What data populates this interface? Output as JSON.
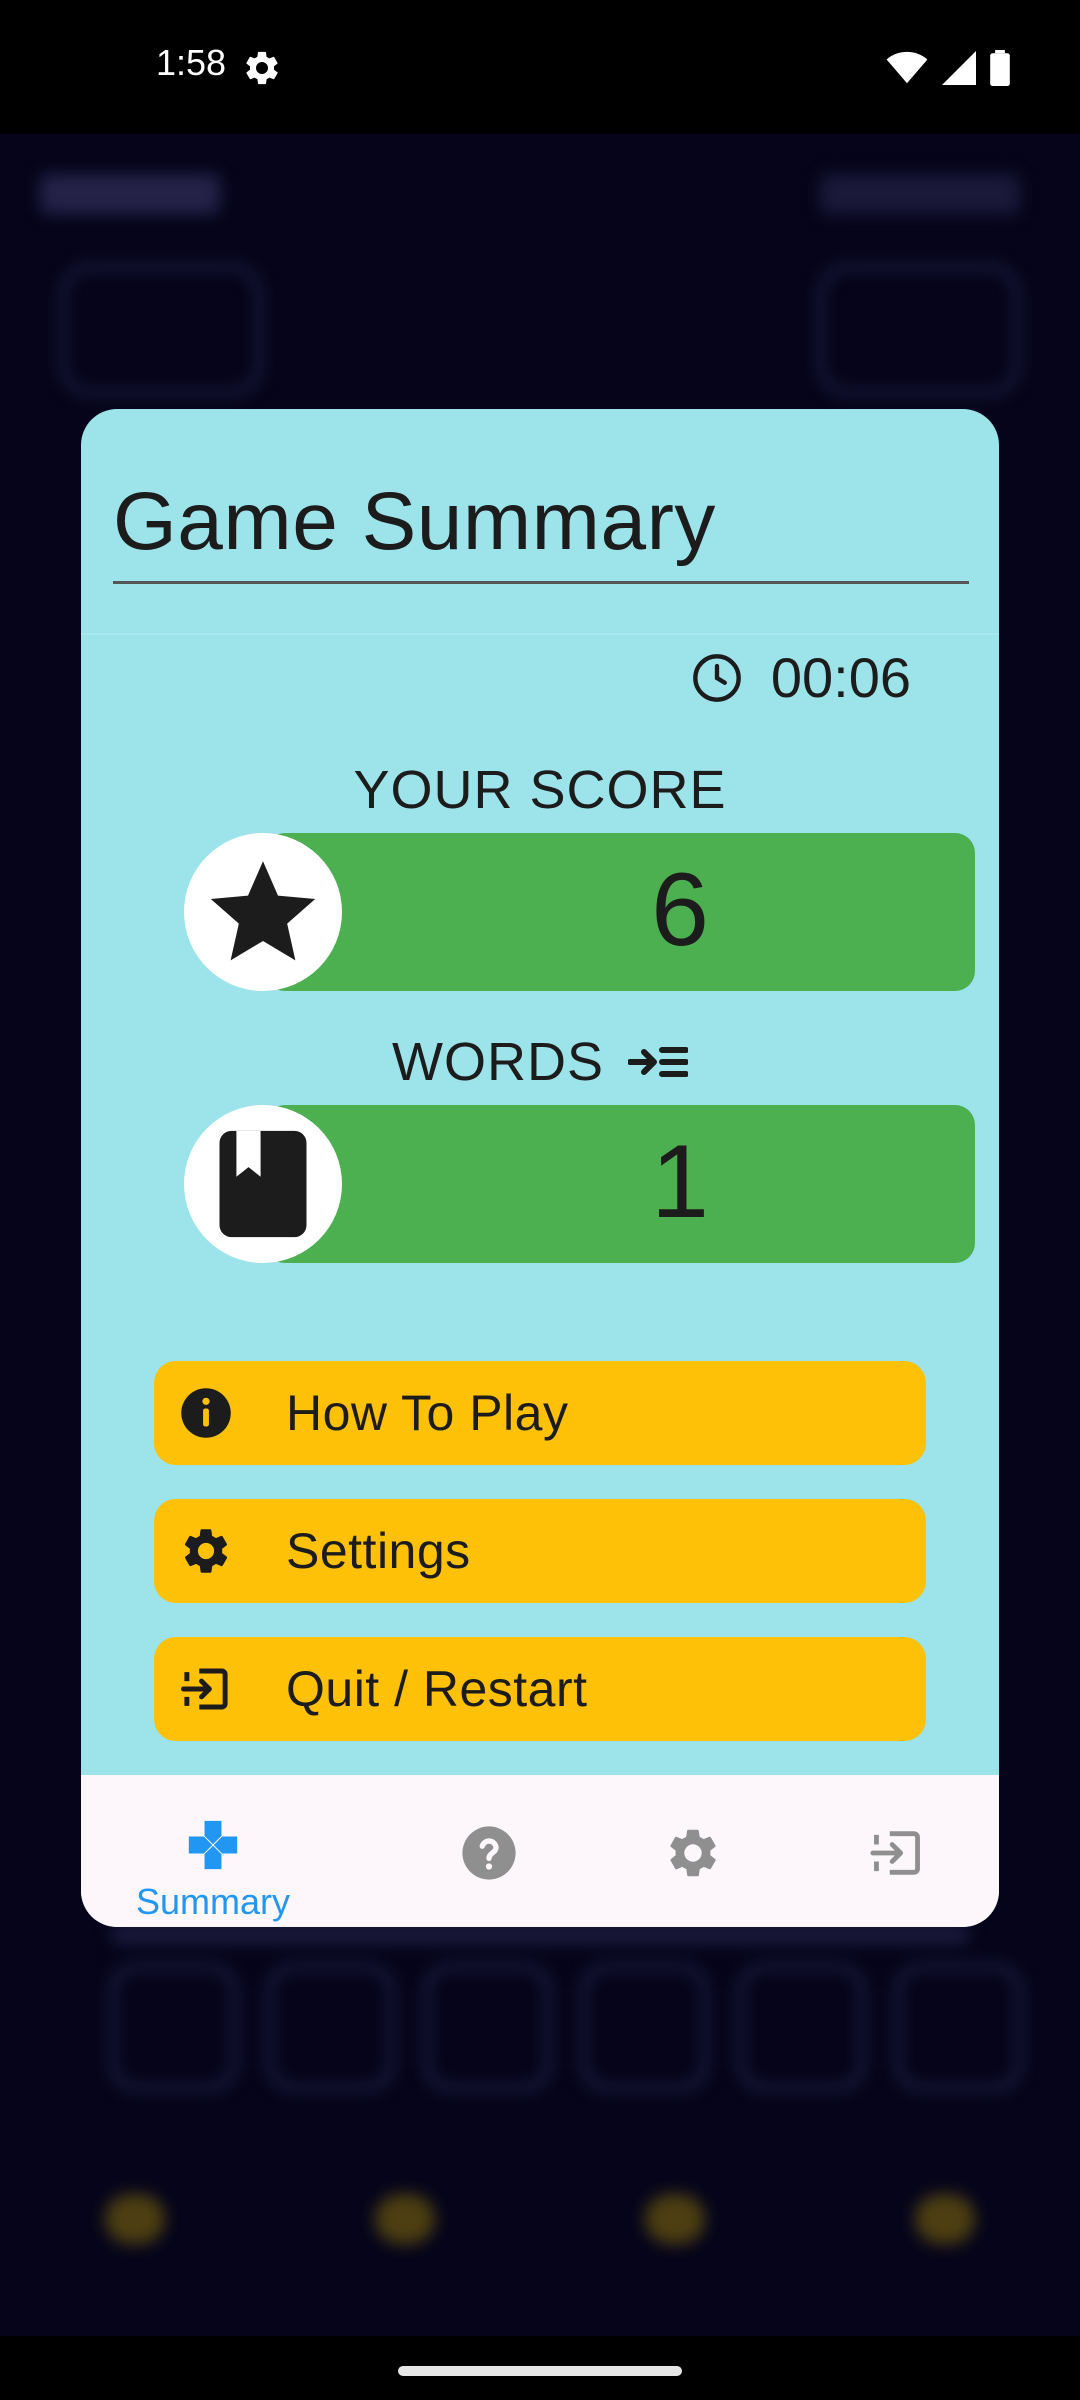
{
  "status_bar": {
    "time": "1:58"
  },
  "dialog": {
    "title": "Game Summary",
    "timer": "00:06",
    "score": {
      "label": "YOUR SCORE",
      "value": "6"
    },
    "words": {
      "label": "WORDS",
      "value": "1"
    },
    "buttons": [
      {
        "label": "How To Play",
        "icon": "info-icon"
      },
      {
        "label": "Settings",
        "icon": "gear-icon"
      },
      {
        "label": "Quit / Restart",
        "icon": "exit-icon"
      }
    ],
    "nav": [
      {
        "label": "Summary",
        "icon": "gamepad-icon",
        "active": true
      },
      {
        "label": "",
        "icon": "help-icon"
      },
      {
        "label": "",
        "icon": "gear-icon"
      },
      {
        "label": "",
        "icon": "exit-icon"
      }
    ]
  },
  "colors": {
    "dialog_bg": "#9ce3ea",
    "stat_bar": "#4caf50",
    "button": "#ffc107",
    "active_nav": "#2196f3",
    "inactive_nav": "#888888"
  }
}
